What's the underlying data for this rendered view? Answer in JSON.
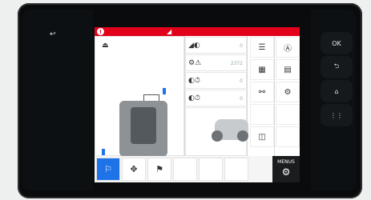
{
  "bezel": {
    "back_left": "↩",
    "ok_label": "OK",
    "back_label": "⮌",
    "home_label": "⌂",
    "grid_label": "⋮⋮"
  },
  "topbar": {
    "alert_glyph": "!",
    "brand_glyph": "◢"
  },
  "panel_values": {
    "row1": "0",
    "row2": "2372",
    "row3": "0",
    "row4": "0"
  },
  "tags": {
    "tag1": "",
    "tag2": "",
    "bottom_left_tag": ""
  },
  "menu": {
    "label": "MENUS"
  },
  "colors": {
    "accent_red": "#e2001a",
    "accent_blue": "#1e73e8"
  }
}
